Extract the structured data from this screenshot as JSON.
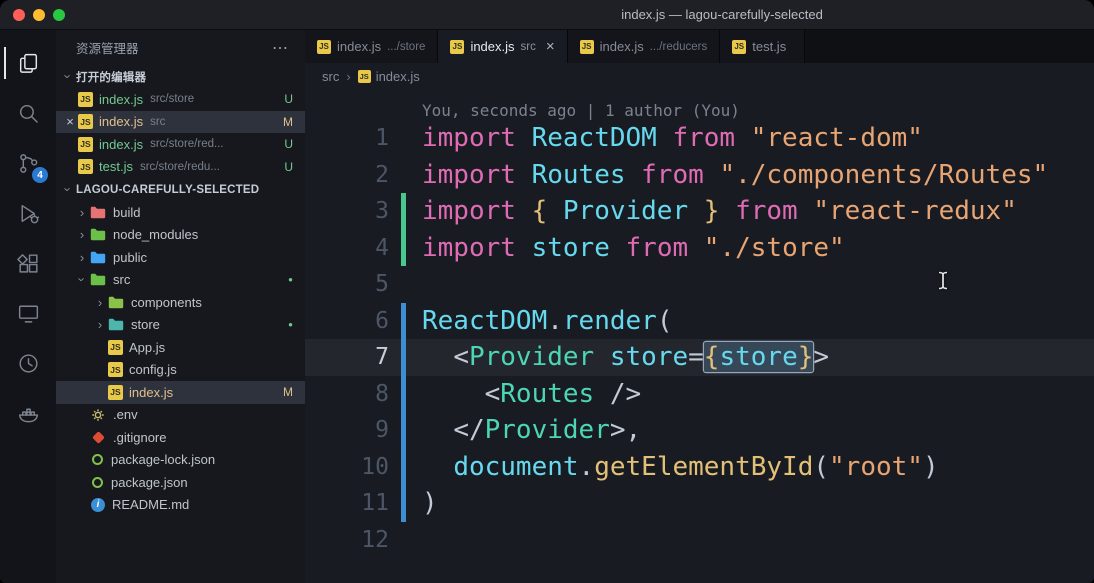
{
  "titlebar": {
    "title": "index.js — lagou-carefully-selected"
  },
  "icons": {
    "chevron": "›",
    "more": "⋯",
    "close": "×",
    "dot": "●",
    "js_text": "JS",
    "info_text": "i"
  },
  "colors": {
    "badge_blue": "#2a7ad2",
    "git_added_gutter": "#48c78e",
    "git_modified_gutter": "#3e8ed0",
    "untracked_green": "#73c991",
    "modified_yellow": "#e2c08d",
    "selection_border": "#97a5b8",
    "js_icon_yellow": "#e8c94a"
  },
  "activity_bar": {
    "items": [
      {
        "name": "explorer",
        "icon": "explorer",
        "active": true
      },
      {
        "name": "search",
        "icon": "search",
        "active": false
      },
      {
        "name": "source-control",
        "icon": "source-control",
        "active": false,
        "badge": "4"
      },
      {
        "name": "run-debug",
        "icon": "debug",
        "active": false
      },
      {
        "name": "extensions",
        "icon": "extensions",
        "active": false
      },
      {
        "name": "remote-explorer",
        "icon": "remote",
        "active": false
      },
      {
        "name": "timeline",
        "icon": "timeline",
        "active": false
      },
      {
        "name": "docker",
        "icon": "docker",
        "active": false
      }
    ]
  },
  "sidebar": {
    "title": "资源管理器",
    "open_editors": {
      "header": "打开的编辑器",
      "items": [
        {
          "name": "index.js",
          "path": "src/store",
          "badge": "U",
          "status": "untracked",
          "active": false,
          "close": ""
        },
        {
          "name": "index.js",
          "path": "src",
          "badge": "M",
          "status": "modified",
          "active": true,
          "close": "×"
        },
        {
          "name": "index.js",
          "path": "src/store/red...",
          "badge": "U",
          "status": "untracked",
          "active": false,
          "close": ""
        },
        {
          "name": "test.js",
          "path": "src/store/redu...",
          "badge": "U",
          "status": "untracked",
          "active": false,
          "close": ""
        }
      ]
    },
    "tree": {
      "root": "LAGOU-CAREFULLY-SELECTED",
      "items": [
        {
          "label": "build",
          "kind": "folder",
          "depth": 0,
          "open": false,
          "color": "#e57373"
        },
        {
          "label": "node_modules",
          "kind": "folder",
          "depth": 0,
          "open": false,
          "color": "#6cc04a"
        },
        {
          "label": "public",
          "kind": "folder",
          "depth": 0,
          "open": false,
          "color": "#42a5f5"
        },
        {
          "label": "src",
          "kind": "folder",
          "depth": 0,
          "open": true,
          "color": "#6cc04a",
          "dot": true
        },
        {
          "label": "components",
          "kind": "folder",
          "depth": 1,
          "open": false,
          "color": "#8bc34a"
        },
        {
          "label": "store",
          "kind": "folder",
          "depth": 1,
          "open": false,
          "color": "#4db6ac",
          "dot": true
        },
        {
          "label": "App.js",
          "kind": "file",
          "icon": "js",
          "depth": 1
        },
        {
          "label": "config.js",
          "kind": "file",
          "icon": "js",
          "depth": 1
        },
        {
          "label": "index.js",
          "kind": "file",
          "icon": "js",
          "depth": 1,
          "selected": true,
          "badge": "M",
          "status": "modified"
        },
        {
          "label": ".env",
          "kind": "file",
          "icon": "env",
          "depth": 0
        },
        {
          "label": ".gitignore",
          "kind": "file",
          "icon": "git",
          "depth": 0
        },
        {
          "label": "package-lock.json",
          "kind": "file",
          "icon": "json",
          "depth": 0
        },
        {
          "label": "package.json",
          "kind": "file",
          "icon": "json",
          "depth": 0
        },
        {
          "label": "README.md",
          "kind": "file",
          "icon": "info",
          "depth": 0
        }
      ]
    }
  },
  "tabs": [
    {
      "name": "index.js",
      "detail": ".../store",
      "active": false,
      "close": ""
    },
    {
      "name": "index.js",
      "detail": "src",
      "active": true,
      "close": "×"
    },
    {
      "name": "index.js",
      "detail": ".../reducers",
      "active": false,
      "close": ""
    },
    {
      "name": "test.js",
      "detail": "",
      "active": false,
      "close": ""
    }
  ],
  "breadcrumb": {
    "items": [
      "src",
      "index.js"
    ],
    "separator": "›"
  },
  "editor": {
    "codelens": "You, seconds ago | 1 author (You)",
    "lines": [
      {
        "num": "1",
        "gutter": "none",
        "tokens": [
          {
            "t": "import ",
            "c": "kw"
          },
          {
            "t": "ReactDOM",
            "c": "id"
          },
          {
            "t": " ",
            "c": "pl"
          },
          {
            "t": "from",
            "c": "kw"
          },
          {
            "t": " ",
            "c": "pl"
          },
          {
            "t": "\"react-dom\"",
            "c": "str"
          }
        ]
      },
      {
        "num": "2",
        "gutter": "none",
        "tokens": [
          {
            "t": "import ",
            "c": "kw"
          },
          {
            "t": "Routes",
            "c": "id"
          },
          {
            "t": " ",
            "c": "pl"
          },
          {
            "t": "from",
            "c": "kw"
          },
          {
            "t": " ",
            "c": "pl"
          },
          {
            "t": "\"./components/Routes\"",
            "c": "str"
          }
        ]
      },
      {
        "num": "3",
        "gutter": "added",
        "tokens": [
          {
            "t": "import ",
            "c": "kw"
          },
          {
            "t": "{ ",
            "c": "br"
          },
          {
            "t": "Provider",
            "c": "id"
          },
          {
            "t": " }",
            "c": "br"
          },
          {
            "t": " ",
            "c": "pl"
          },
          {
            "t": "from",
            "c": "kw"
          },
          {
            "t": " ",
            "c": "pl"
          },
          {
            "t": "\"react-redux\"",
            "c": "str"
          }
        ]
      },
      {
        "num": "4",
        "gutter": "added",
        "tokens": [
          {
            "t": "import ",
            "c": "kw"
          },
          {
            "t": "store",
            "c": "id"
          },
          {
            "t": " ",
            "c": "pl"
          },
          {
            "t": "from",
            "c": "kw"
          },
          {
            "t": " ",
            "c": "pl"
          },
          {
            "t": "\"./store\"",
            "c": "str"
          }
        ]
      },
      {
        "num": "5",
        "gutter": "none",
        "tokens": []
      },
      {
        "num": "6",
        "gutter": "modified",
        "tokens": [
          {
            "t": "ReactDOM",
            "c": "id"
          },
          {
            "t": ".",
            "c": "pun"
          },
          {
            "t": "render",
            "c": "id"
          },
          {
            "t": "(",
            "c": "pun"
          }
        ]
      },
      {
        "num": "7",
        "gutter": "modified",
        "current": true,
        "tokens": [
          {
            "t": "  ",
            "c": "pl"
          },
          {
            "t": "<",
            "c": "pun"
          },
          {
            "t": "Provider",
            "c": "tag"
          },
          {
            "t": " ",
            "c": "pl"
          },
          {
            "t": "store",
            "c": "attr"
          },
          {
            "t": "=",
            "c": "pun"
          },
          {
            "group": [
              {
                "t": "{",
                "c": "br"
              },
              {
                "t": "store",
                "c": "id"
              },
              {
                "t": "}",
                "c": "br"
              }
            ]
          },
          {
            "t": ">",
            "c": "pun"
          }
        ]
      },
      {
        "num": "8",
        "gutter": "modified",
        "tokens": [
          {
            "t": "    ",
            "c": "pl"
          },
          {
            "t": "<",
            "c": "pun"
          },
          {
            "t": "Routes",
            "c": "tag"
          },
          {
            "t": " ",
            "c": "pl"
          },
          {
            "t": "/>",
            "c": "pun"
          }
        ]
      },
      {
        "num": "9",
        "gutter": "modified",
        "tokens": [
          {
            "t": "  ",
            "c": "pl"
          },
          {
            "t": "</",
            "c": "pun"
          },
          {
            "t": "Provider",
            "c": "tag"
          },
          {
            "t": ">,",
            "c": "pun"
          }
        ]
      },
      {
        "num": "10",
        "gutter": "modified",
        "tokens": [
          {
            "t": "  ",
            "c": "pl"
          },
          {
            "t": "document",
            "c": "id"
          },
          {
            "t": ".",
            "c": "pun"
          },
          {
            "t": "getElementById",
            "c": "fn"
          },
          {
            "t": "(",
            "c": "pun"
          },
          {
            "t": "\"root\"",
            "c": "str"
          },
          {
            "t": ")",
            "c": "pun"
          }
        ]
      },
      {
        "num": "11",
        "gutter": "modified",
        "tokens": [
          {
            "t": ")",
            "c": "pun"
          }
        ]
      },
      {
        "num": "12",
        "gutter": "none",
        "tokens": []
      }
    ]
  }
}
